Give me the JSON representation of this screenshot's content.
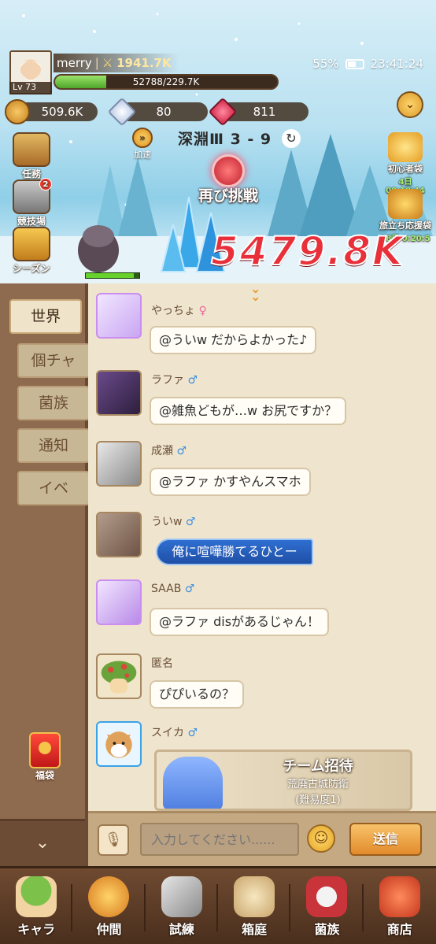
{
  "player": {
    "name": "merry",
    "level": "Lv 73",
    "power": "1941.7K",
    "exp_text": "52788/229.7K",
    "exp_fraction": 0.23
  },
  "status": {
    "battery": "55%",
    "battery_fraction": 0.55,
    "time": "23:41:24"
  },
  "currencies": [
    {
      "value": "509.6K",
      "icon": "coin-icon"
    },
    {
      "value": "80",
      "icon": "diamond-icon"
    },
    {
      "value": "811",
      "icon": "ruby-icon"
    }
  ],
  "side_menu": [
    {
      "label": "任務",
      "icon": "quest-board-icon"
    },
    {
      "label": "競技場",
      "icon": "arena-swords-icon",
      "badge": "2"
    },
    {
      "label": "シーズン",
      "icon": "season-chest-icon"
    }
  ],
  "stage": {
    "speed_label": "加速",
    "name": "深淵Ⅲ 3 - 9",
    "retry_label": "再び挑戦"
  },
  "right_packs": [
    {
      "label": "初心者袋",
      "timer": "4日 00:18:44"
    },
    {
      "label": "旅立ち応援袋",
      "timer": "18日 0:20:5"
    }
  ],
  "damage": "5479.8K",
  "chat_tabs": [
    "世界",
    "個チャ",
    "菌族",
    "通知",
    "イベ"
  ],
  "fukubukuro_label": "福袋",
  "messages": [
    {
      "name": "やっちょ",
      "gender": "♀",
      "text": "@ういw だからよかった♪"
    },
    {
      "name": "ラファ",
      "gender": "♂",
      "text": "@雑魚どもが…w お尻ですか？"
    },
    {
      "name": "成瀬",
      "gender": "♂",
      "text": "@ラファ かすやんスマホ"
    },
    {
      "name": "ういw",
      "gender": "♂",
      "text": "俺に喧嘩勝てるひとー"
    },
    {
      "name": "SAAB",
      "gender": "♂",
      "text": "@ラファ disがあるじゃん！"
    },
    {
      "name": "匿名",
      "gender": "",
      "text": "ぴぴいるの？"
    },
    {
      "name": "スイカ",
      "gender": "♂",
      "text": ""
    }
  ],
  "team_invite": {
    "title": "チーム招待",
    "place": "荒廃古城防衛",
    "difficulty": "(難易度1)"
  },
  "input": {
    "placeholder": "入力してください......",
    "send_label": "送信"
  },
  "bottom_nav": [
    {
      "label": "キャラ",
      "icon": "mushroom-icon"
    },
    {
      "label": "仲間",
      "icon": "paw-icon"
    },
    {
      "label": "試練",
      "icon": "crossed-swords-icon"
    },
    {
      "label": "箱庭",
      "icon": "garden-house-icon"
    },
    {
      "label": "菌族",
      "icon": "skull-banner-icon"
    },
    {
      "label": "商店",
      "icon": "shop-icon"
    }
  ]
}
